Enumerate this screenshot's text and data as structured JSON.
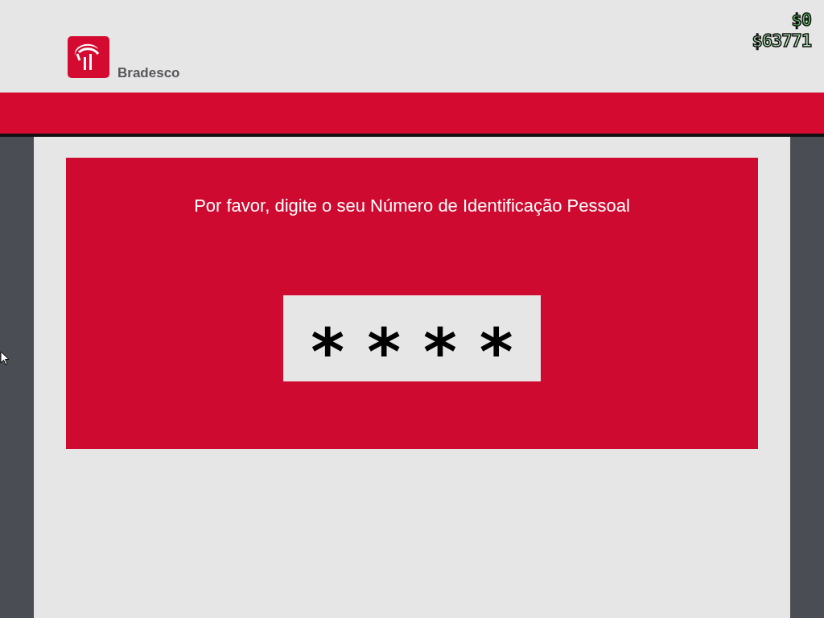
{
  "header": {
    "brand": "Bradesco"
  },
  "hud": {
    "cash": "$0",
    "bank": "$63771"
  },
  "prompt": "Por favor, digite o seu Número de Identificação Pessoal",
  "pin": {
    "mask": [
      "*",
      "*",
      "*",
      "*"
    ]
  }
}
